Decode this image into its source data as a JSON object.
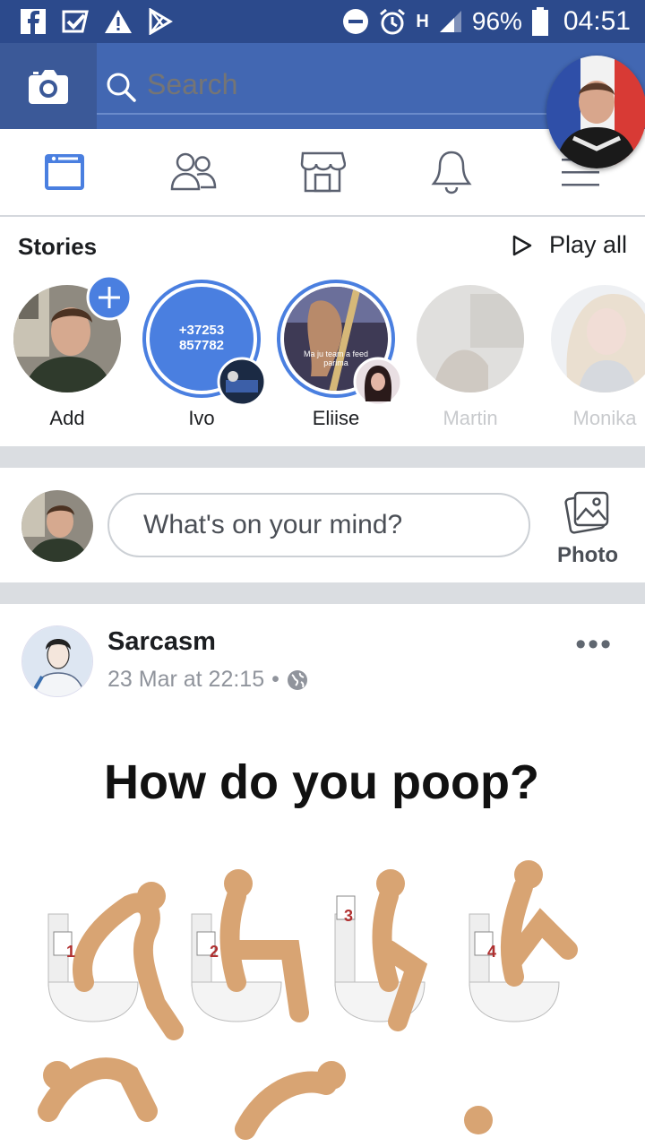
{
  "status_bar": {
    "battery": "96%",
    "time": "04:51",
    "network": "H",
    "left_icons": [
      "facebook-icon",
      "check-icon",
      "warning-icon",
      "play-store-icon"
    ],
    "right_icons": [
      "do-not-disturb-icon",
      "alarm-icon",
      "signal-icon",
      "battery-icon"
    ]
  },
  "top_bar": {
    "search_placeholder": "Search",
    "camera_icon": "camera-icon"
  },
  "nav_tabs": [
    {
      "name": "news-feed",
      "icon": "newsfeed-icon",
      "active": true
    },
    {
      "name": "friends",
      "icon": "friends-icon",
      "active": false
    },
    {
      "name": "marketplace",
      "icon": "marketplace-icon",
      "active": false
    },
    {
      "name": "notifications",
      "icon": "bell-icon",
      "active": false
    },
    {
      "name": "menu",
      "icon": "menu-icon",
      "active": false
    }
  ],
  "stories": {
    "title": "Stories",
    "play_all": "Play all",
    "items": [
      {
        "name": "Add",
        "type": "add"
      },
      {
        "name": "Ivo",
        "type": "text",
        "text_line1": "+37253",
        "text_line2": "857782"
      },
      {
        "name": "Eliise",
        "type": "photo",
        "caption_line1": "Ma ju team a feed",
        "caption_line2": "parima"
      },
      {
        "name": "Martin",
        "type": "seen"
      },
      {
        "name": "Monika",
        "type": "seen"
      }
    ]
  },
  "composer": {
    "placeholder": "What's on your mind?",
    "photo_label": "Photo"
  },
  "post": {
    "author": "Sarcasm",
    "timestamp": "23 Mar at 22:15",
    "separator": "•",
    "more": "•••",
    "image_title": "How do you poop?",
    "numbers": [
      "1",
      "2",
      "3",
      "4"
    ]
  },
  "colors": {
    "status_bar": "#2c4a8c",
    "top_bar": "#4267b2",
    "accent": "#4a7fe0",
    "divider": "#dadde1"
  }
}
